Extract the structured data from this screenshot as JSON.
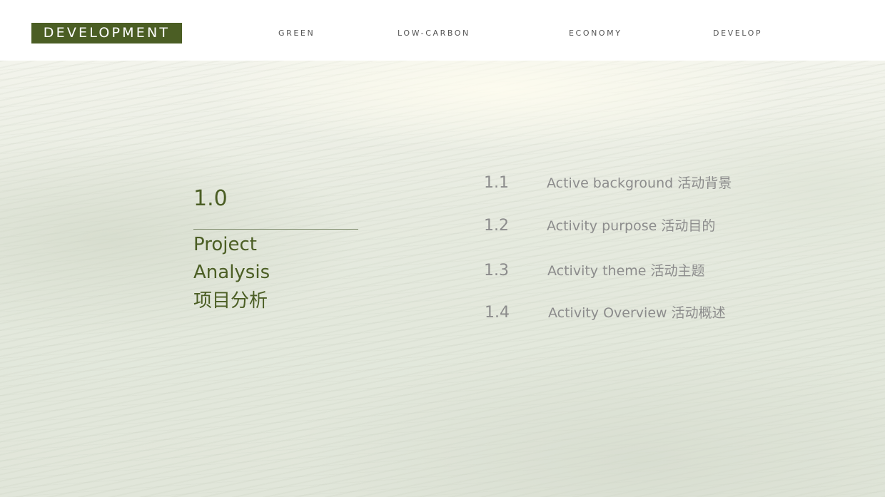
{
  "header": {
    "logo": "DEVELOPMENT",
    "nav": [
      "GREEN",
      "LOW-CARBON",
      "ECONOMY",
      "DEVELOP"
    ]
  },
  "section": {
    "number": "1.0",
    "title_line1": "Project",
    "title_line2": "Analysis",
    "title_cn": "项目分析"
  },
  "toc": [
    {
      "num": "1.1",
      "label": "Active background  活动背景"
    },
    {
      "num": "1.2",
      "label": "Activity purpose  活动目的"
    },
    {
      "num": "1.3",
      "label": "Activity theme 活动主题"
    },
    {
      "num": "1.4",
      "label": "Activity Overview 活动概述"
    }
  ],
  "colors": {
    "accent": "#4b5e24",
    "toc_text": "#8c8c8c",
    "nav_text": "#555555"
  }
}
